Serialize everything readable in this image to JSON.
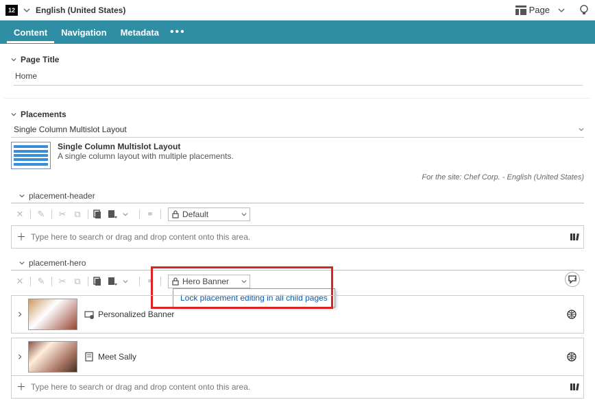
{
  "topbar": {
    "locale_badge": "12",
    "language": "English (United States)",
    "page_label": "Page"
  },
  "tabs": {
    "content": "Content",
    "navigation": "Navigation",
    "metadata": "Metadata"
  },
  "page_title": {
    "label": "Page Title",
    "value": "Home"
  },
  "placements": {
    "label": "Placements",
    "layout_name": "Single Column Multislot Layout",
    "layout_title": "Single Column Multislot Layout",
    "layout_desc": "A single column layout with multiple placements.",
    "site_note": "For the site: Chef Corp. - English (United States)"
  },
  "placement_header": {
    "title": "placement-header",
    "lock_label": "Default",
    "drop_placeholder": "Type here to search or drag and drop content onto this area."
  },
  "placement_hero": {
    "title": "placement-hero",
    "lock_label": "Hero Banner",
    "popup_item": "Lock placement editing in all child pages",
    "card1_title": "Personalized Banner",
    "card2_title": "Meet Sally",
    "drop_placeholder": "Type here to search or drag and drop content onto this area."
  }
}
